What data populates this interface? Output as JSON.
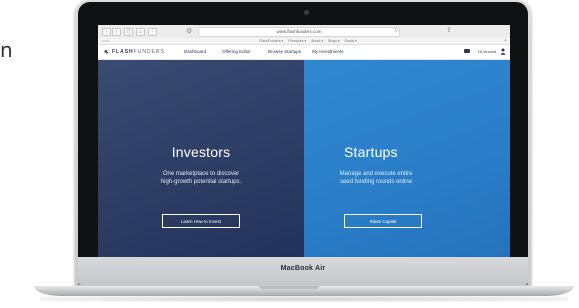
{
  "edge_text": "n",
  "laptop": {
    "brand_label": "MacBook Air"
  },
  "browser": {
    "url": "www.flashfunders.com",
    "bookmarks": [
      "FlashFunders ▾",
      "Principles ▾",
      "About ▾",
      "Blogs ▾",
      "Social ▾"
    ],
    "tab_add": "+",
    "tab_left": "▭▭"
  },
  "site": {
    "logo": {
      "bold": "FLASH",
      "light": "FUNDERS"
    },
    "nav": [
      "Dashboard",
      "Offering Editor",
      "Browse Startups",
      "My Investments"
    ],
    "greeting": "Hi Vincent"
  },
  "hero": {
    "investors": {
      "title": "Investors",
      "subtitle_line1": "One marketplace to discover",
      "subtitle_line2": "high-growth potential startups.",
      "button": "Learn How to Invest"
    },
    "startups": {
      "title": "Startups",
      "subtitle_line1": "Manage and execute entire",
      "subtitle_line2": "seed funding rounds online",
      "button": "Raise Capital"
    }
  },
  "colors": {
    "investors_bg": "#2b3b62",
    "startups_bg": "#2a7ec8",
    "nav_text": "#2b3a55"
  },
  "icons": [
    "back-icon",
    "forward-icon",
    "sidebar-icon",
    "home-icon",
    "gear-icon",
    "refresh-icon",
    "share-icon",
    "mail-icon",
    "user-icon"
  ]
}
